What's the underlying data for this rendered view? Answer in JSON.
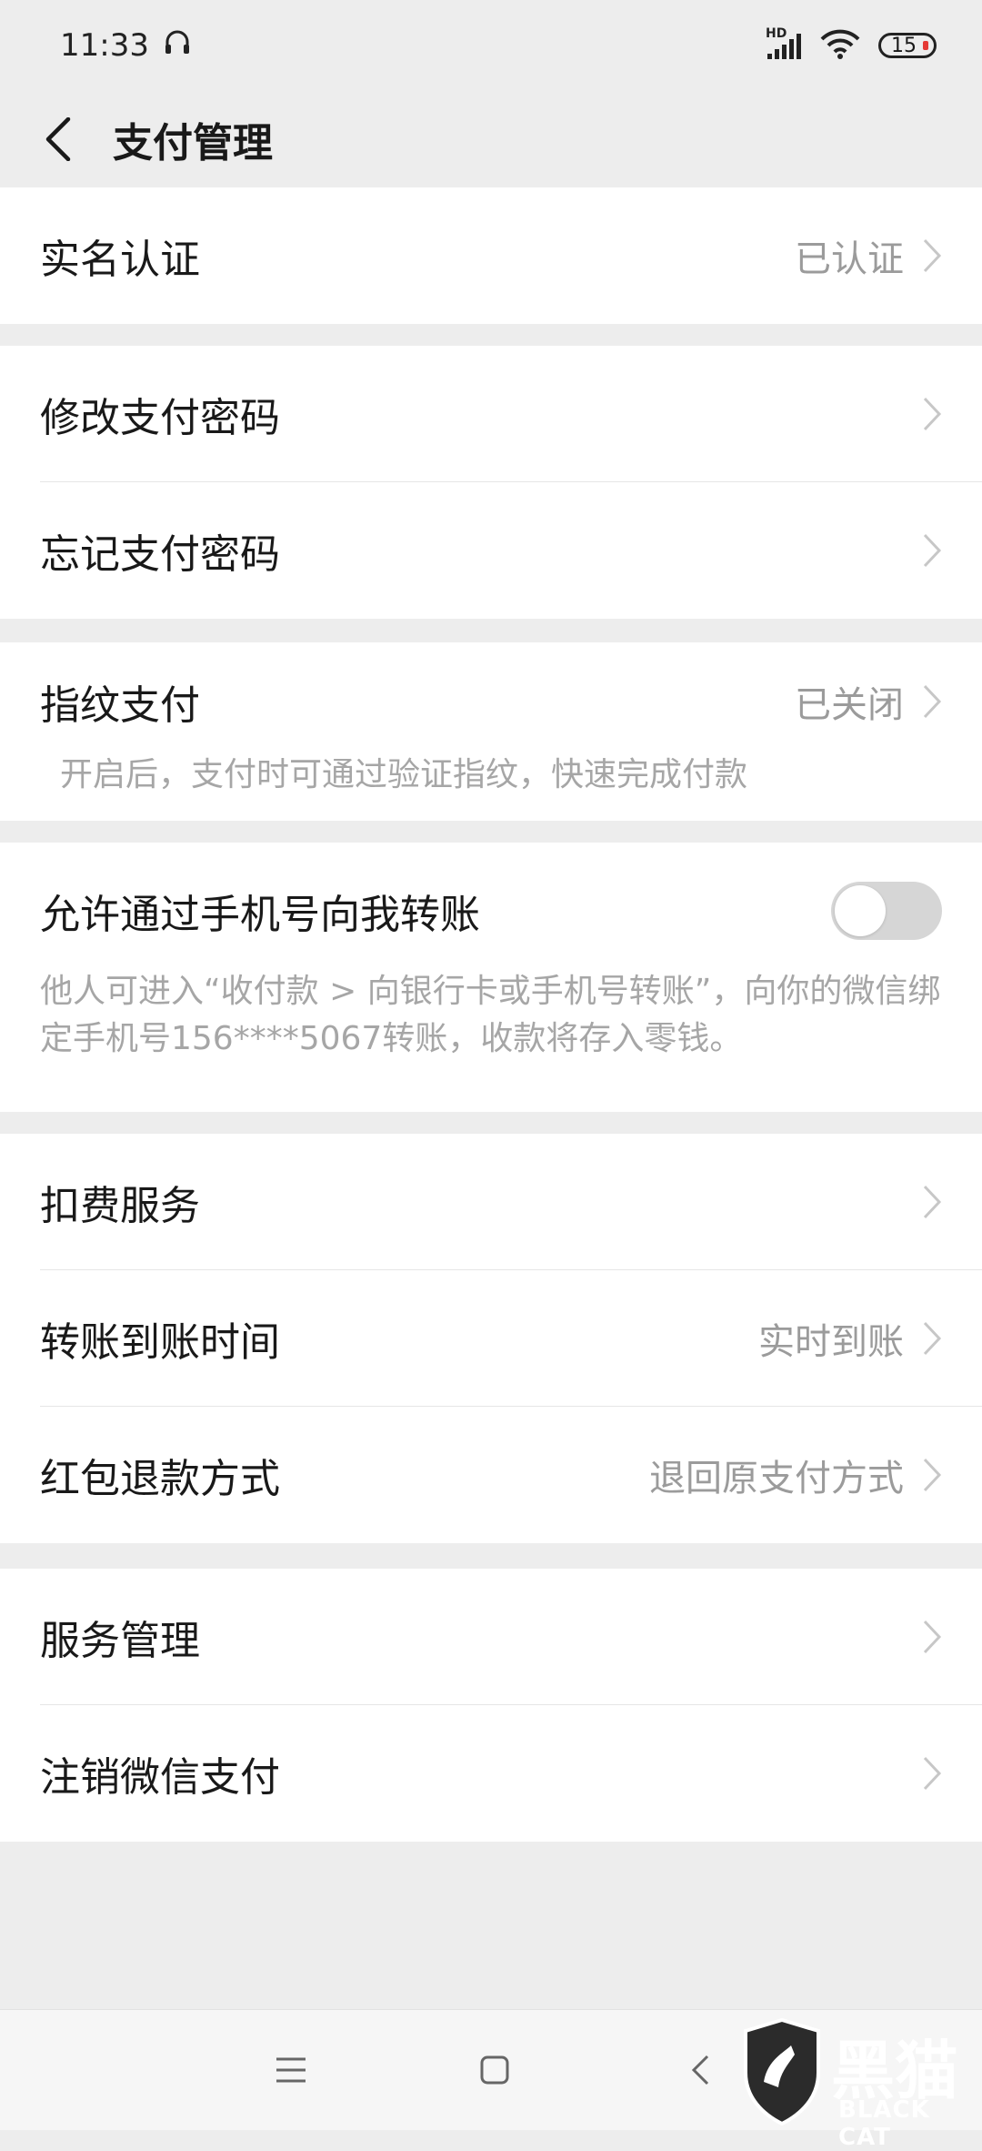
{
  "status_bar": {
    "time": "11:33",
    "network_label": "HD",
    "battery_level": "15"
  },
  "header": {
    "title": "支付管理"
  },
  "groups": {
    "g1": {
      "real_name": {
        "label": "实名认证",
        "value": "已认证"
      }
    },
    "g2": {
      "change_password": {
        "label": "修改支付密码"
      },
      "forgot_password": {
        "label": "忘记支付密码"
      }
    },
    "g3": {
      "fingerprint": {
        "label": "指纹支付",
        "value": "已关闭",
        "description": "开启后，支付时可通过验证指纹，快速完成付款"
      }
    },
    "g4": {
      "phone_transfer": {
        "label": "允许通过手机号向我转账",
        "enabled": false,
        "description": "他人可进入“收付款 > 向银行卡或手机号转账”，向你的微信绑定手机号156****5067转账，收款将存入零钱。"
      }
    },
    "g5": {
      "deduction": {
        "label": "扣费服务"
      },
      "transfer_time": {
        "label": "转账到账时间",
        "value": "实时到账"
      },
      "red_packet_refund": {
        "label": "红包退款方式",
        "value": "退回原支付方式"
      }
    },
    "g6": {
      "service_manage": {
        "label": "服务管理"
      },
      "cancel_wechat_pay": {
        "label": "注销微信支付"
      }
    }
  },
  "watermark": {
    "chinese": "黑猫",
    "english": "BLACK CAT"
  }
}
